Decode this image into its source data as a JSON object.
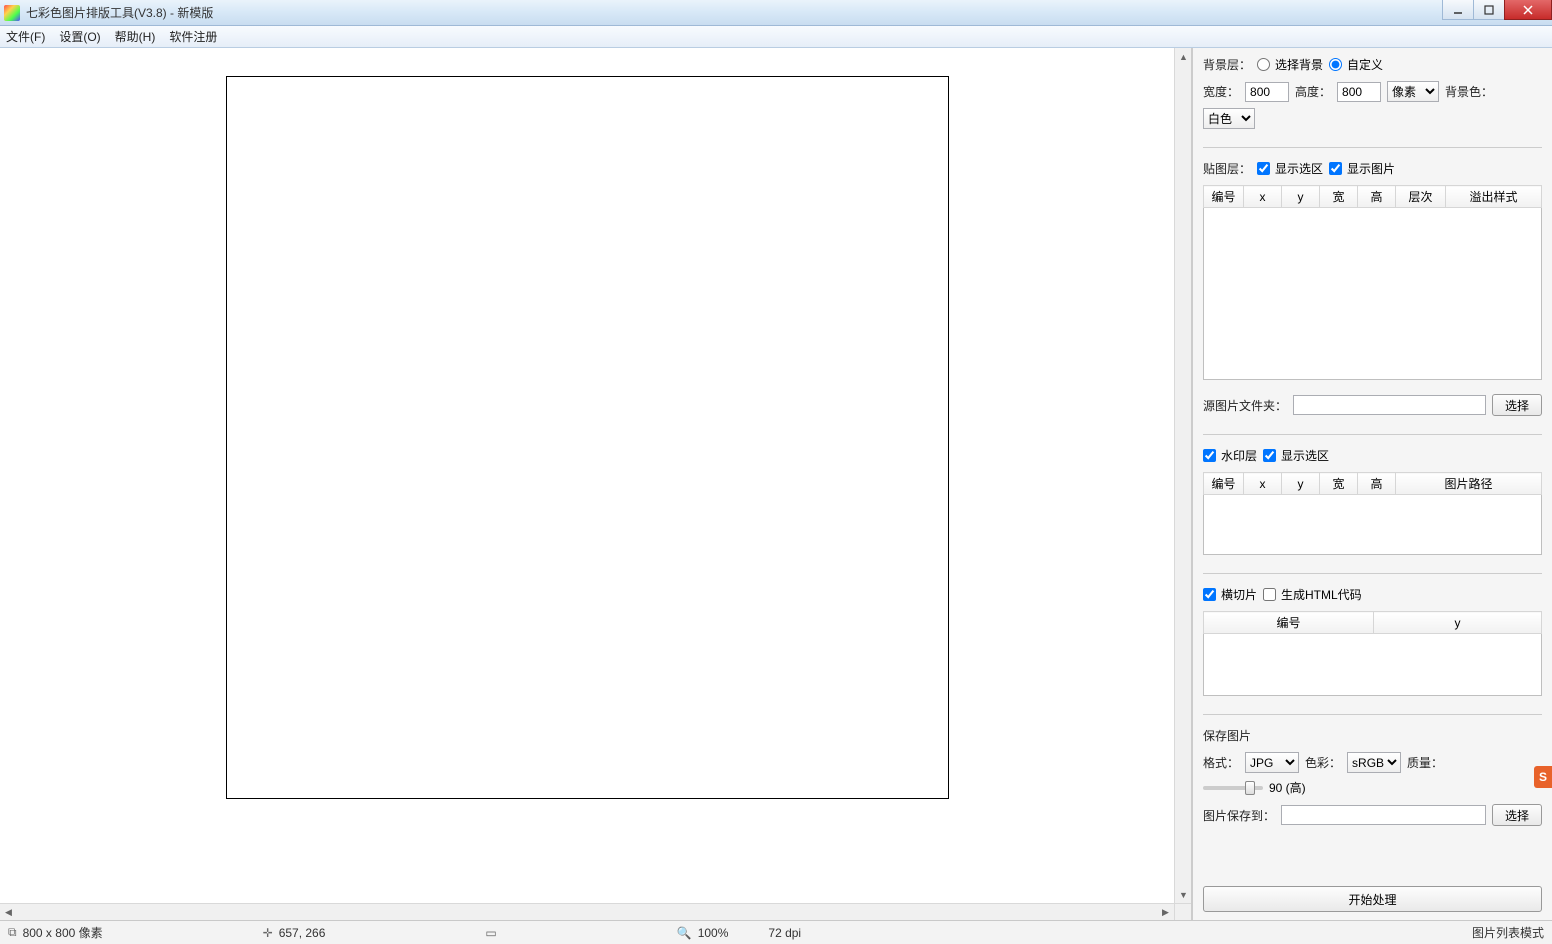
{
  "window": {
    "title": "七彩色图片排版工具(V3.8) - 新模版"
  },
  "menu": {
    "file": "文件(F)",
    "settings": "设置(O)",
    "help": "帮助(H)",
    "register": "软件注册"
  },
  "bg_layer": {
    "label": "背景层：",
    "radio_select_bg": "选择背景",
    "radio_custom": "自定义",
    "radio_selected": "custom",
    "width_label": "宽度：",
    "width_value": "800",
    "height_label": "高度：",
    "height_value": "800",
    "unit_options": [
      "像素"
    ],
    "unit_selected": "像素",
    "bgcolor_label": "背景色：",
    "bgcolor_options": [
      "白色"
    ],
    "bgcolor_selected": "白色"
  },
  "paste_layer": {
    "label": "贴图层：",
    "chk_show_selection": "显示选区",
    "chk_show_selection_checked": true,
    "chk_show_image": "显示图片",
    "chk_show_image_checked": true,
    "columns": [
      "编号",
      "x",
      "y",
      "宽",
      "高",
      "层次",
      "溢出样式"
    ]
  },
  "source_folder": {
    "label": "源图片文件夹：",
    "value": "",
    "button": "选择"
  },
  "watermark_layer": {
    "chk_enable": "水印层",
    "chk_enable_checked": true,
    "chk_show_selection": "显示选区",
    "chk_show_selection_checked": true,
    "columns": [
      "编号",
      "x",
      "y",
      "宽",
      "高",
      "图片路径"
    ]
  },
  "slice": {
    "chk_hslice": "横切片",
    "chk_hslice_checked": true,
    "chk_html": "生成HTML代码",
    "chk_html_checked": false,
    "columns": [
      "编号",
      "y"
    ]
  },
  "save": {
    "section_label": "保存图片",
    "format_label": "格式：",
    "format_options": [
      "JPG"
    ],
    "format_selected": "JPG",
    "color_label": "色彩：",
    "color_options": [
      "sRGB"
    ],
    "color_selected": "sRGB",
    "quality_label": "质量：",
    "quality_value": "90 (高)",
    "save_to_label": "图片保存到：",
    "save_to_value": "",
    "save_to_button": "选择"
  },
  "start_button": "开始处理",
  "status": {
    "size": "800 x 800 像素",
    "coords": "657, 266",
    "zoom": "100%",
    "dpi": "72 dpi",
    "mode": "图片列表模式"
  },
  "sogou_badge": "S"
}
